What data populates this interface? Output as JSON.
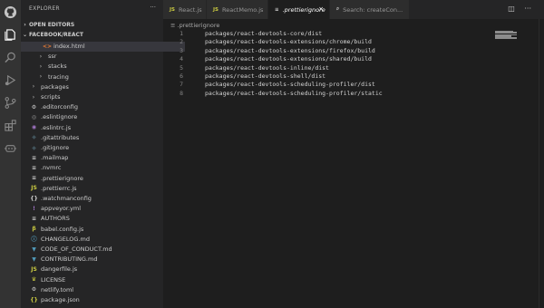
{
  "colors": {
    "activity_bar": "#333333",
    "sidebar": "#252526",
    "editor": "#1e1e1e",
    "tab_inactive": "#2d2d2d",
    "active_row": "#37373d"
  },
  "activity_bar": {
    "icons": [
      "github-icon",
      "files-icon",
      "search-icon",
      "run-debug-icon",
      "source-control-icon",
      "extensions-icon",
      "remote-icon"
    ]
  },
  "sidebar": {
    "title": "EXPLORER",
    "more": "···",
    "open_editors": "OPEN EDITORS",
    "project": "FACEBOOK/REACT",
    "items": [
      {
        "label": "index.html",
        "icon": "<>",
        "icon_color": "#e37933",
        "chevron": "",
        "indent": 14,
        "active": true
      },
      {
        "label": "ssr",
        "icon": "",
        "icon_color": "",
        "chevron": "›",
        "indent": 8,
        "active": false
      },
      {
        "label": "stacks",
        "icon": "",
        "icon_color": "",
        "chevron": "›",
        "indent": 8,
        "active": false
      },
      {
        "label": "tracing",
        "icon": "",
        "icon_color": "",
        "chevron": "›",
        "indent": 8,
        "active": false
      },
      {
        "label": "packages",
        "icon": "",
        "icon_color": "",
        "chevron": "›",
        "indent": 0,
        "active": false
      },
      {
        "label": "scripts",
        "icon": "",
        "icon_color": "",
        "chevron": "›",
        "indent": 0,
        "active": false
      },
      {
        "label": ".editorconfig",
        "icon": "⚙",
        "icon_color": "#cccccc",
        "chevron": "",
        "indent": 0,
        "active": false
      },
      {
        "label": ".eslintignore",
        "icon": "◎",
        "icon_color": "#9b9b9b",
        "chevron": "",
        "indent": 0,
        "active": false
      },
      {
        "label": ".eslintrc.js",
        "icon": "◉",
        "icon_color": "#a074c4",
        "chevron": "",
        "indent": 0,
        "active": false
      },
      {
        "label": ".gitattributes",
        "icon": "◆",
        "icon_color": "#41535b",
        "chevron": "",
        "indent": 0,
        "active": false
      },
      {
        "label": ".gitignore",
        "icon": "◆",
        "icon_color": "#41535b",
        "chevron": "",
        "indent": 0,
        "active": false
      },
      {
        "label": ".mailmap",
        "icon": "≡",
        "icon_color": "#cccccc",
        "chevron": "",
        "indent": 0,
        "active": false
      },
      {
        "label": ".nvmrc",
        "icon": "≡",
        "icon_color": "#cccccc",
        "chevron": "",
        "indent": 0,
        "active": false
      },
      {
        "label": ".prettierignore",
        "icon": "≡",
        "icon_color": "#cccccc",
        "chevron": "",
        "indent": 0,
        "active": false
      },
      {
        "label": ".prettierrc.js",
        "icon": "JS",
        "icon_color": "#cbcb41",
        "chevron": "",
        "indent": 0,
        "active": false
      },
      {
        "label": ".watchmanconfig",
        "icon": "{}",
        "icon_color": "#cccccc",
        "chevron": "",
        "indent": 0,
        "active": false
      },
      {
        "label": "appveyor.yml",
        "icon": "!",
        "icon_color": "#a074c4",
        "chevron": "",
        "indent": 0,
        "active": false
      },
      {
        "label": "AUTHORS",
        "icon": "≡",
        "icon_color": "#cccccc",
        "chevron": "",
        "indent": 0,
        "active": false
      },
      {
        "label": "babel.config.js",
        "icon": "β",
        "icon_color": "#cbcb41",
        "chevron": "",
        "indent": 0,
        "active": false
      },
      {
        "label": "CHANGELOG.md",
        "icon": "ⓘ",
        "icon_color": "#519aba",
        "chevron": "",
        "indent": 0,
        "active": false
      },
      {
        "label": "CODE_OF_CONDUCT.md",
        "icon": "▼",
        "icon_color": "#519aba",
        "chevron": "",
        "indent": 0,
        "active": false
      },
      {
        "label": "CONTRIBUTING.md",
        "icon": "▼",
        "icon_color": "#519aba",
        "chevron": "",
        "indent": 0,
        "active": false
      },
      {
        "label": "dangerfile.js",
        "icon": "JS",
        "icon_color": "#cbcb41",
        "chevron": "",
        "indent": 0,
        "active": false
      },
      {
        "label": "LICENSE",
        "icon": "♛",
        "icon_color": "#cbcb41",
        "chevron": "",
        "indent": 0,
        "active": false
      },
      {
        "label": "netlify.toml",
        "icon": "⚙",
        "icon_color": "#cccccc",
        "chevron": "",
        "indent": 0,
        "active": false
      },
      {
        "label": "package.json",
        "icon": "{}",
        "icon_color": "#cbcb41",
        "chevron": "",
        "indent": 0,
        "active": false
      }
    ]
  },
  "tabs": [
    {
      "label": "React.js",
      "icon": "JS",
      "icon_color": "#cbcb41",
      "active": false
    },
    {
      "label": "ReactMemo.js",
      "icon": "JS",
      "icon_color": "#cbcb41",
      "active": false
    },
    {
      "label": ".prettierignore",
      "icon": "≡",
      "icon_color": "#cccccc",
      "active": true
    },
    {
      "label": "Search: createCon...",
      "icon": "⌕",
      "icon_color": "#cccccc",
      "active": false
    }
  ],
  "editor_actions": [
    "split-editor-icon",
    "more-actions-icon"
  ],
  "breadcrumb": "≡ .prettierignore",
  "code_lines": [
    "packages/react-devtools-core/dist",
    "packages/react-devtools-extensions/chrome/build",
    "packages/react-devtools-extensions/firefox/build",
    "packages/react-devtools-extensions/shared/build",
    "packages/react-devtools-inline/dist",
    "packages/react-devtools-shell/dist",
    "packages/react-devtools-scheduling-profiler/dist",
    "packages/react-devtools-scheduling-profiler/static"
  ]
}
